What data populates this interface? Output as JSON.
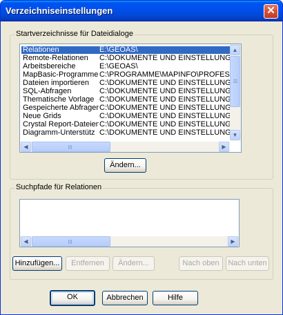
{
  "window": {
    "title": "Verzeichniseinstellungen",
    "close_symbol": "✕"
  },
  "start_dirs": {
    "group_label": "Startverzeichnisse für Dateidialoge",
    "rows": [
      {
        "name": "Relationen",
        "path": "E:\\GEOAS\\",
        "selected": true
      },
      {
        "name": "Remote-Relationen",
        "path": "C:\\DOKUMENTE UND EINSTELLUNG"
      },
      {
        "name": "Arbeitsbereiche",
        "path": "E:\\GEOAS\\"
      },
      {
        "name": "MapBasic-Programme",
        "path": "C:\\PROGRAMME\\MAPINFO\\PROFES"
      },
      {
        "name": "Dateien importieren",
        "path": "C:\\DOKUMENTE UND EINSTELLUNG"
      },
      {
        "name": "SQL-Abfragen",
        "path": "C:\\DOKUMENTE UND EINSTELLUNG"
      },
      {
        "name": "Thematische Vorlage",
        "path": "C:\\DOKUMENTE UND EINSTELLUNG"
      },
      {
        "name": "Gespeicherte Abfragen",
        "path": "C:\\DOKUMENTE UND EINSTELLUNG"
      },
      {
        "name": "Neue Grids",
        "path": "C:\\DOKUMENTE UND EINSTELLUNG"
      },
      {
        "name": "Crystal Report-Dateien",
        "path": "C:\\DOKUMENTE UND EINSTELLUNG"
      },
      {
        "name": "Diagramm-Unterstütz",
        "path": "C:\\DOKUMENTE UND EINSTELLUNG"
      }
    ],
    "change_button": "Ändern..."
  },
  "search_paths": {
    "group_label": "Suchpfade für Relationen",
    "buttons": {
      "add": "Hinzufügen...",
      "remove": "Entfernen",
      "change": "Ändern...",
      "move_up": "Nach oben",
      "move_down": "Nach unten"
    }
  },
  "footer": {
    "ok": "OK",
    "cancel": "Abbrechen",
    "help": "Hilfe"
  },
  "icons": {
    "up": "▲",
    "down": "▼",
    "left": "◀",
    "right": "▶"
  }
}
